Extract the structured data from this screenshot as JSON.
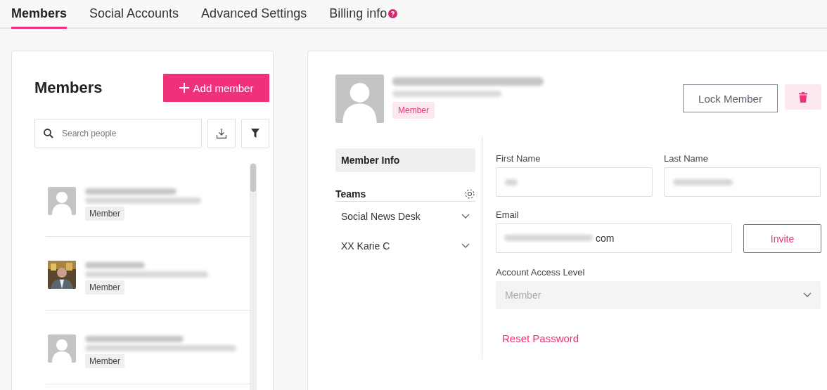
{
  "tabs": [
    {
      "label": "Members",
      "selected": true,
      "help_icon": false
    },
    {
      "label": "Social Accounts",
      "selected": false,
      "help_icon": false
    },
    {
      "label": "Advanced Settings",
      "selected": false,
      "help_icon": false
    },
    {
      "label": "Billing info",
      "selected": false,
      "help_icon": true
    }
  ],
  "members_panel": {
    "title": "Members",
    "add_button": "Add member",
    "search": {
      "placeholder": "Search people"
    },
    "members": [
      {
        "kind": "placeholder",
        "role": "Member"
      },
      {
        "kind": "picture",
        "role": "Member"
      },
      {
        "kind": "placeholder",
        "role": "Member"
      }
    ]
  },
  "detail": {
    "role_badge": "Member",
    "lock_button": "Lock Member",
    "nav": [
      {
        "label": "Member Info",
        "selected": true
      }
    ],
    "teams_heading": "Teams",
    "teams": [
      {
        "label": "Social News Desk",
        "expanded": false
      },
      {
        "label": "XX Karie C",
        "expanded": false
      }
    ],
    "form": {
      "first_name_label": "First Name",
      "last_name_label": "Last Name",
      "email_label": "Email",
      "email_value": "com",
      "invite_button": "Invite",
      "access_label": "Account Access Level",
      "access_value": "Member",
      "access_disabled": true,
      "reset_link": "Reset Password"
    }
  }
}
